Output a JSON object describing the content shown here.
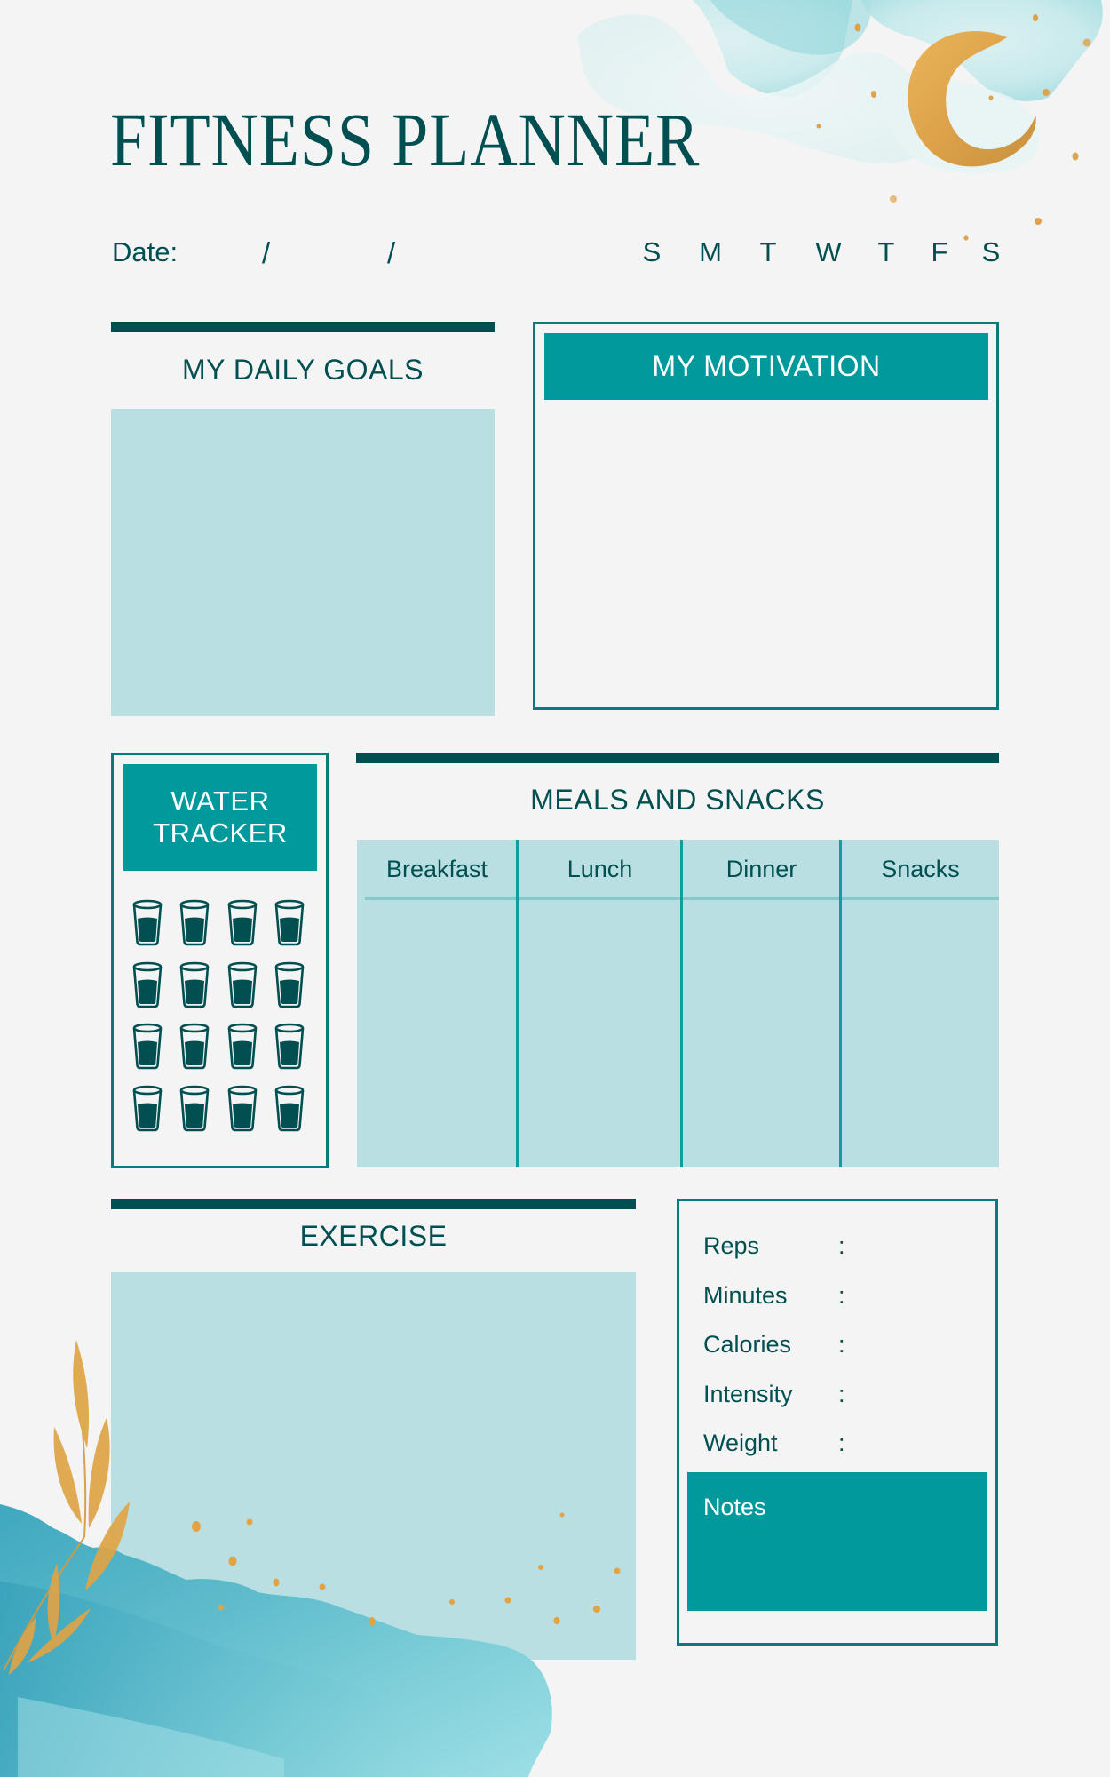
{
  "title": "FITNESS PLANNER",
  "date": {
    "label": "Date:",
    "separator_1": "/",
    "separator_2": "/"
  },
  "weekdays": [
    "S",
    "M",
    "T",
    "W",
    "T",
    "F",
    "S"
  ],
  "daily_goals": {
    "label": "MY DAILY GOALS"
  },
  "motivation": {
    "label": "MY MOTIVATION"
  },
  "water_tracker": {
    "label_line1": "WATER",
    "label_line2": "TRACKER",
    "glass_count": 16,
    "icon": "water-glass-icon"
  },
  "meals": {
    "label": "MEALS AND SNACKS",
    "columns": [
      "Breakfast",
      "Lunch",
      "Dinner",
      "Snacks"
    ]
  },
  "exercise": {
    "label": "EXERCISE"
  },
  "stats": {
    "rows": [
      {
        "label": "Reps",
        "sep": ":"
      },
      {
        "label": "Minutes",
        "sep": ":"
      },
      {
        "label": "Calories",
        "sep": ":"
      },
      {
        "label": "Intensity",
        "sep": ":"
      },
      {
        "label": "Weight",
        "sep": ":"
      }
    ],
    "notes_label": "Notes"
  },
  "decorations": {
    "top_right": [
      "watercolor-splash",
      "crescent-moon-icon",
      "gold-dots"
    ],
    "bottom_left": [
      "watercolor-splash",
      "gold-leaf-branch-icon",
      "gold-dots"
    ]
  },
  "colors": {
    "background": "#f4f4f4",
    "dark_teal": "#024f51",
    "teal": "#02999d",
    "light_teal": "#b9dfe2",
    "border_teal": "#0b7a7a",
    "gold": "#e0a445"
  }
}
